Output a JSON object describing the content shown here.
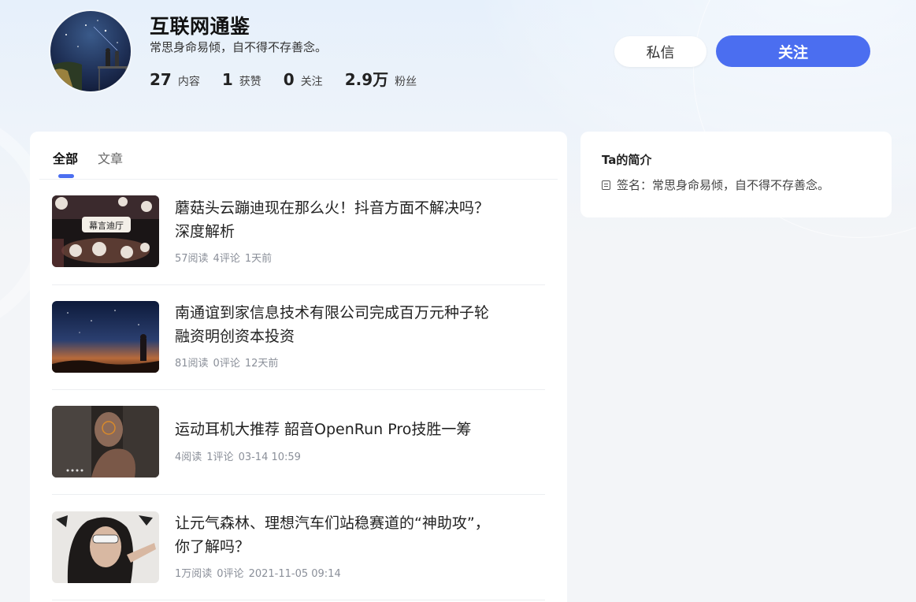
{
  "profile": {
    "name": "互联网通鉴",
    "bio": "常思身命易倾，自不得不存善念。",
    "stats": [
      {
        "num": "27",
        "label": "内容"
      },
      {
        "num": "1",
        "label": "获赞"
      },
      {
        "num": "0",
        "label": "关注"
      },
      {
        "num": "2.9万",
        "label": "粉丝"
      }
    ]
  },
  "actions": {
    "message_label": "私信",
    "follow_label": "关注"
  },
  "tabs": [
    {
      "label": "全部",
      "active": true
    },
    {
      "label": "文章",
      "active": false
    }
  ],
  "articles": [
    {
      "title": "蘑菇头云蹦迪现在那么火！抖音方面不解决吗？深度解析",
      "reads": "57阅读",
      "comments": "4评论",
      "time": "1天前",
      "thumb_text": "幕言迪厅"
    },
    {
      "title": "南通谊到家信息技术有限公司完成百万元种子轮融资明创资本投资",
      "reads": "81阅读",
      "comments": "0评论",
      "time": "12天前"
    },
    {
      "title": "运动耳机大推荐 韶音OpenRun Pro技胜一筹",
      "reads": "4阅读",
      "comments": "1评论",
      "time": "03-14 10:59"
    },
    {
      "title": "让元气森林、理想汽车们站稳赛道的“神助攻”，你了解吗？",
      "reads": "1万阅读",
      "comments": "0评论",
      "time": "2021-11-05 09:14"
    }
  ],
  "intro": {
    "title": "Ta的简介",
    "signature": "签名：常思身命易倾，自不得不存善念。"
  },
  "colors": {
    "accent": "#4b6ef0",
    "page_bg": "#f3f5f8"
  }
}
